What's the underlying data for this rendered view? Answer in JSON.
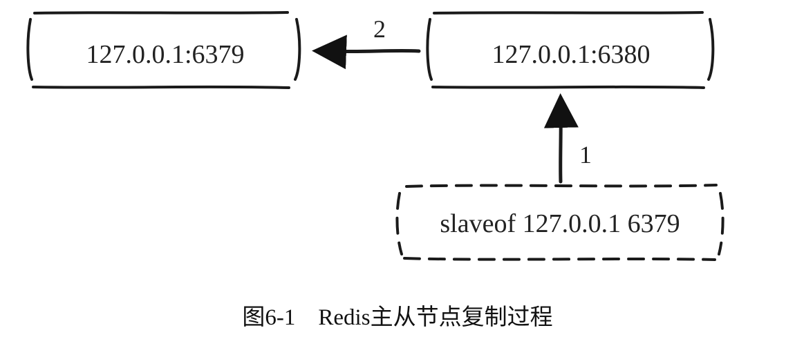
{
  "nodes": {
    "master": {
      "label": "127.0.0.1:6379"
    },
    "slave": {
      "label": "127.0.0.1:6380"
    },
    "command": {
      "label": "slaveof 127.0.0.1 6379"
    }
  },
  "edges": {
    "step1": {
      "label": "1"
    },
    "step2": {
      "label": "2"
    }
  },
  "caption": {
    "text": "图6-1　Redis主从节点复制过程"
  }
}
